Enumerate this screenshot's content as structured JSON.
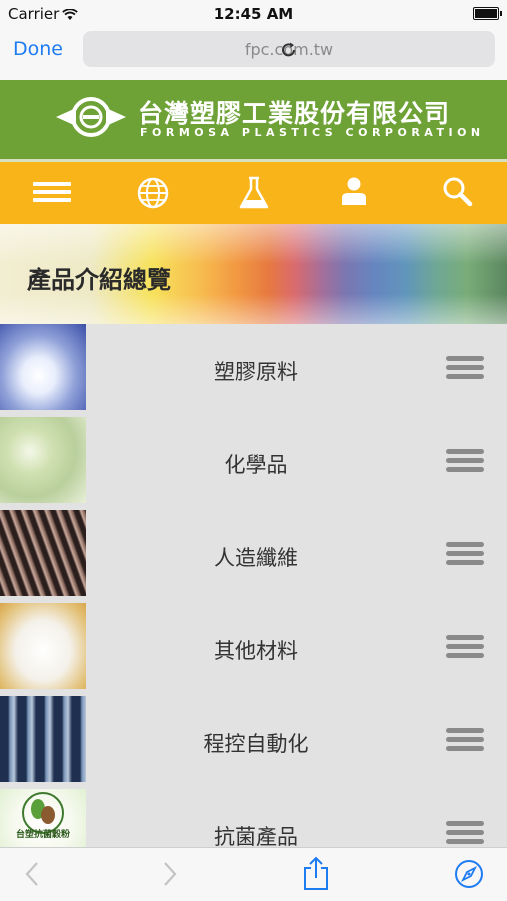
{
  "status_bar": {
    "carrier": "Carrier",
    "time": "12:45 AM"
  },
  "nav": {
    "done_label": "Done",
    "url": "fpc.com.tw"
  },
  "brand": {
    "name_zh": "台灣塑膠工業股份有限公司",
    "name_en": "FORMOSA PLASTICS CORPORATION"
  },
  "menu": {
    "items": [
      "menu-icon",
      "globe-icon",
      "flask-icon",
      "user-icon",
      "search-icon"
    ]
  },
  "banner": {
    "title": "產品介紹總覽"
  },
  "products": [
    {
      "label": "塑膠原料",
      "thumb_colors": [
        "#3b4fa8",
        "#eef3ff"
      ]
    },
    {
      "label": "化學品",
      "thumb_colors": [
        "#b9cf9c",
        "#e8efd8"
      ]
    },
    {
      "label": "人造纖維",
      "thumb_colors": [
        "#2b1f1e",
        "#c9a99c"
      ]
    },
    {
      "label": "其他材料",
      "thumb_colors": [
        "#d9a64a",
        "#f4f1ea"
      ]
    },
    {
      "label": "程控自動化",
      "thumb_colors": [
        "#1f2f4f",
        "#7894b8"
      ]
    },
    {
      "label": "抗菌產品",
      "thumb_colors": [
        "#d6ecc4",
        "#f6f9ee"
      ],
      "thumb_text": "台塑抗菌穀粉"
    }
  ],
  "toolbar": {
    "items": [
      "back-icon",
      "forward-icon",
      "share-icon",
      "compass-icon"
    ]
  }
}
